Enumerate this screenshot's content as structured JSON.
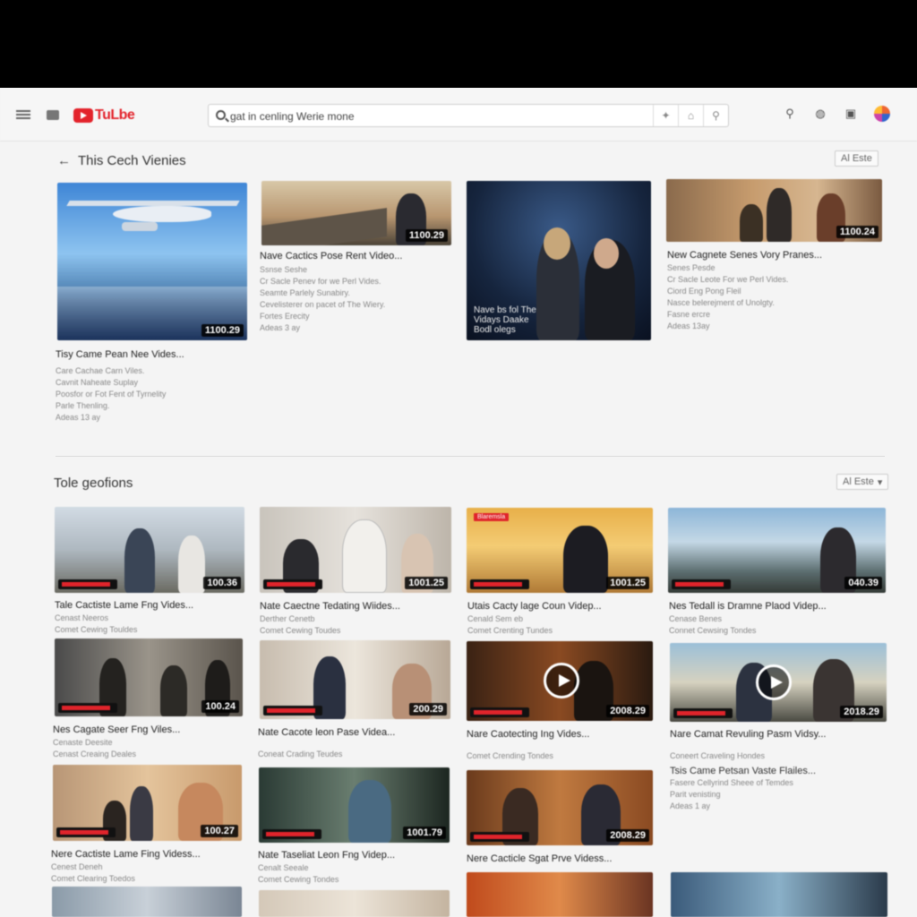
{
  "header": {
    "logo_text": "TuLbe",
    "search_value": "gat in cenling Werie mone",
    "icons": [
      "menu-icon",
      "grid-icon",
      "search-icon",
      "mic-icon",
      "home-icon",
      "search-icon",
      "bell-icon",
      "shop-icon",
      "avatar"
    ]
  },
  "section1": {
    "title": "This Cech Vienies",
    "sort_label": "Al Este",
    "videos": [
      {
        "duration": "1100.29",
        "title": "Tisy Came Pean Nee Vides...",
        "meta": [
          "Care Cachae Carn Viles.",
          "Cavnit Naheate Suplay",
          "Poosfor or Fot Fent of Tyrnelity",
          "Parle Thenling.",
          "Adeas 13 ay"
        ]
      },
      {
        "duration": "1100.29",
        "title": "Nave Cactics Pose Rent Video...",
        "meta": [
          "Ssnse Seshe",
          "Cr Sacle Penev for we Perl Vides.",
          "Seamte Parlely Sunabiry.",
          "Cevelisterer on pacet of The Wiery.",
          "Fortes Erecity",
          "Adeas 3 ay"
        ]
      },
      {
        "overlay": "Nave bs fol The Vidays Daake Bodl olegs",
        "title": "",
        "meta": []
      },
      {
        "duration": "1100.24",
        "title": "New Cagnete Senes Vory Pranes...",
        "meta": [
          "Senes Pesde",
          "Cr Sacle Leote For we Perl Vides.",
          "Ciord Eng Pong Fleil",
          "Nasce belerejment of Unolgty.",
          "Fasne ercre",
          "Adeas 13ay"
        ]
      }
    ]
  },
  "section2": {
    "title": "Tole geofions",
    "sort_label": "Al Este",
    "rows": [
      [
        {
          "duration": "100.36",
          "title": "Tale Cactiste Lame Fng Vides...",
          "meta": [
            "Cenast Neeros",
            "Comet Cewing Touldes"
          ]
        },
        {
          "duration": "1001.25",
          "title": "Nate Caectne Tedating Wiides...",
          "meta": [
            "Derther Cenetb",
            "Comet Cewing Toudes"
          ]
        },
        {
          "duration": "1001.25",
          "title": "Utais Cacty lage Coun Videp...",
          "meta": [
            "Cenald Sem eb",
            "Comet Crenting Tundes"
          ],
          "badge": "Blaremsla"
        },
        {
          "duration": "040.39",
          "title": "Nes Tedall is Dramne Plaod Videp...",
          "meta": [
            "Cenase Benes",
            "Connet Cewsing Tondes"
          ]
        }
      ],
      [
        {
          "duration": "100.24",
          "title": "Nes Cagate Seer Fng Viles...",
          "meta": [
            "Cenaste Deesite",
            "Cenast Creaing Deales"
          ]
        },
        {
          "duration": "200.29",
          "title": "Nate Cacote leon Pase Videa...",
          "meta": [
            "Coneat Crading Teudes"
          ]
        },
        {
          "duration": "2008.29",
          "title": "Nare Caotecting Ing Vides...",
          "meta": [
            "Comet Crending Tondes"
          ]
        },
        {
          "duration": "2018.29",
          "title": "Nare Camat Revuling Pasm Vidsy...",
          "meta": [
            "Coneert Craveling Hondes",
            "Tsis Came Petsan Vaste Flailes...",
            "Fasere Cellyrind Sheee of Temdes",
            "Parit venisting",
            "Adeas 1 ay"
          ]
        }
      ],
      [
        {
          "duration": "100.27",
          "title": "Nere Cactiste Lame Fing Videss...",
          "meta": [
            "Cenest Deneh",
            "Comet Clearing Toedos"
          ]
        },
        {
          "duration": "1001.79",
          "title": "Nate Taseliat Leon Fng Videp...",
          "meta": [
            "Cenalt Seeale",
            "Comet Cewing Tondes"
          ]
        },
        {
          "duration": "2008.29",
          "title": "Nere Cacticle Sgat Prve Videss...",
          "meta": []
        },
        {
          "title": "",
          "meta": []
        }
      ]
    ]
  }
}
